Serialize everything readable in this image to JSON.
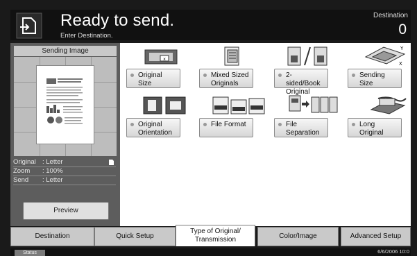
{
  "header": {
    "title": "Ready to send.",
    "subtitle": "Enter Destination.",
    "destination_label": "Destination",
    "destination_count": "0"
  },
  "left_panel": {
    "title": "Sending Image",
    "info": [
      {
        "key": "Original",
        "value": ": Letter"
      },
      {
        "key": "Zoom",
        "value": ": 100%"
      },
      {
        "key": "Send",
        "value": ": Letter"
      }
    ],
    "preview_button": "Preview"
  },
  "functions": [
    {
      "label": "Original Size",
      "icon": "original-size-icon"
    },
    {
      "label": "Mixed Sized Originals",
      "icon": "mixed-sized-icon"
    },
    {
      "label": "2-sided/Book Original",
      "icon": "two-sided-icon"
    },
    {
      "label": "Sending Size",
      "icon": "sending-size-icon"
    },
    {
      "label": "Original Orientation",
      "icon": "orientation-icon"
    },
    {
      "label": "File Format",
      "icon": "file-format-icon"
    },
    {
      "label": "File Separation",
      "icon": "file-separation-icon"
    },
    {
      "label": "Long Original",
      "icon": "long-original-icon"
    }
  ],
  "tabs": [
    {
      "label": "Destination",
      "active": false
    },
    {
      "label": "Quick Setup",
      "active": false
    },
    {
      "label": "Type of Original/ Transmission",
      "active": true
    },
    {
      "label": "Color/Image",
      "active": false
    },
    {
      "label": "Advanced Setup",
      "active": false
    }
  ],
  "status": {
    "button": "Status",
    "datetime": "6/6/2006 10:0"
  }
}
